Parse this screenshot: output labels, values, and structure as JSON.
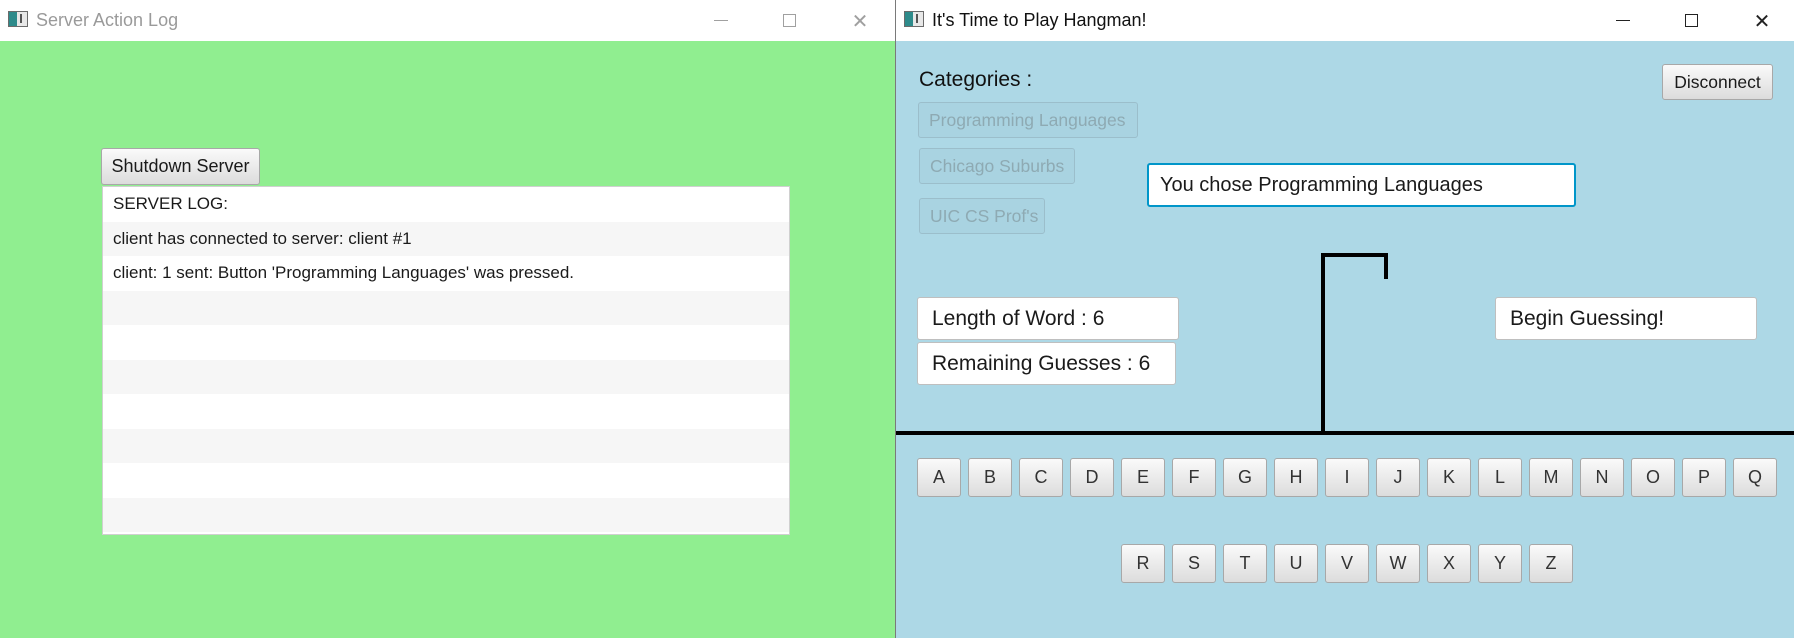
{
  "server_window": {
    "title": "Server Action Log",
    "shutdown_label": "Shutdown Server",
    "log_lines": [
      "SERVER LOG:",
      "client has connected to server: client #1",
      "client: 1 sent: Button 'Programming Languages' was pressed.",
      "",
      "",
      "",
      "",
      "",
      "",
      ""
    ]
  },
  "game_window": {
    "title": "It's Time to Play Hangman!",
    "categories_label": "Categories :",
    "categories": [
      "Programming Languages",
      "Chicago Suburbs",
      "UIC CS Prof's"
    ],
    "disconnect_label": "Disconnect",
    "chosen_text": "You chose Programming Languages",
    "length_text": "Length of Word : 6",
    "remaining_text": "Remaining Guesses : 6",
    "status_text": "Begin Guessing!",
    "letters_row1": [
      "A",
      "B",
      "C",
      "D",
      "E",
      "F",
      "G",
      "H",
      "I",
      "J",
      "K",
      "L",
      "M",
      "N",
      "O",
      "P",
      "Q"
    ],
    "letters_row2": [
      "R",
      "S",
      "T",
      "U",
      "V",
      "W",
      "X",
      "Y",
      "Z"
    ]
  },
  "window_controls": {
    "minimize_icon": "minimize-icon",
    "maximize_icon": "maximize-icon",
    "close_icon": "close-icon",
    "close_glyph": "✕"
  },
  "colors": {
    "server_bg": "#90ee90",
    "game_bg": "#add8e6",
    "focus_border": "#0096c9"
  }
}
